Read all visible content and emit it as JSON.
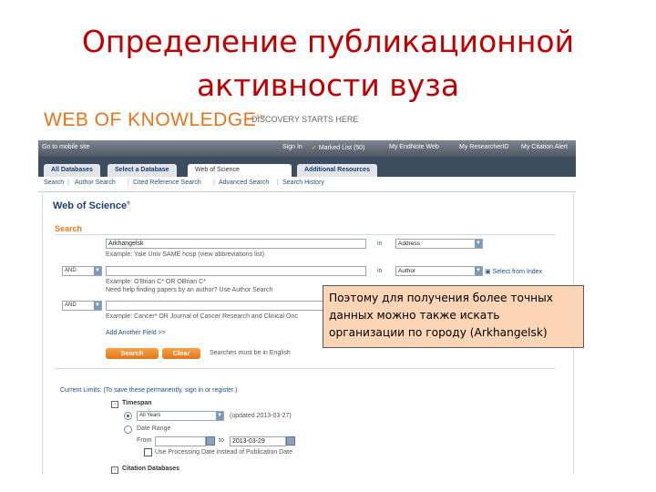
{
  "slide": {
    "title_line1": "Определение публикационной",
    "title_line2": "активности вуза",
    "callout": "Поэтому для получения более точных данных можно также искать организации по городу (Arkhangelsk)"
  },
  "header": {
    "logo": "WEB OF KNOWLEDGE",
    "logo_mark": "SM",
    "tagline": "DISCOVERY STARTS HERE"
  },
  "topbar": {
    "mobile": "Go to mobile site",
    "signin": "Sign In",
    "marked_list": "Marked List (50)",
    "endnote": "My EndNote Web",
    "researcherid": "My ResearcherID",
    "citation_alerts": "My Citation Alert"
  },
  "tabs": [
    {
      "label": "All Databases"
    },
    {
      "label": "Select a Database"
    },
    {
      "label": "Web of Science"
    },
    {
      "label": "Additional Resources"
    }
  ],
  "subnav": [
    "Search",
    "Author Search",
    "Cited Reference Search",
    "Advanced Search",
    "Search History"
  ],
  "main": {
    "title": "Web of Science",
    "title_mark": "®",
    "search_heading": "Search",
    "row1": {
      "value": "Arkhangelsk",
      "in_label": "in",
      "field": "Address",
      "example": "Example: Yale Univ SAME hosp (view abbreviations list)"
    },
    "row2": {
      "bool": "AND",
      "value": "",
      "in_label": "in",
      "field": "Author",
      "select_index": "Select from Index",
      "example": "Example: O'Brian C* OR OBrian C*",
      "hint": "Need help finding papers by an author? Use Author Search"
    },
    "row3": {
      "bool": "AND",
      "example": "Example: Cancer* OR Journal of Cancer Research and Clinical Onc"
    },
    "add_field": "Add Another Field >>",
    "search_btn": "Search",
    "clear_btn": "Clear",
    "english_note": "Searches must be in English"
  },
  "limits": {
    "heading": "Current Limits: (To save these permanently, sign in or register.)",
    "timespan": "Timespan",
    "all_years": "All Years",
    "updated": "(updated 2013-03-27)",
    "date_range": "Date Range",
    "from_label": "From",
    "to_label": "to",
    "to_value": "2013-03-29",
    "processing_date": "Use Processing Date instead of Publication Date",
    "citation_databases": "Citation Databases"
  }
}
